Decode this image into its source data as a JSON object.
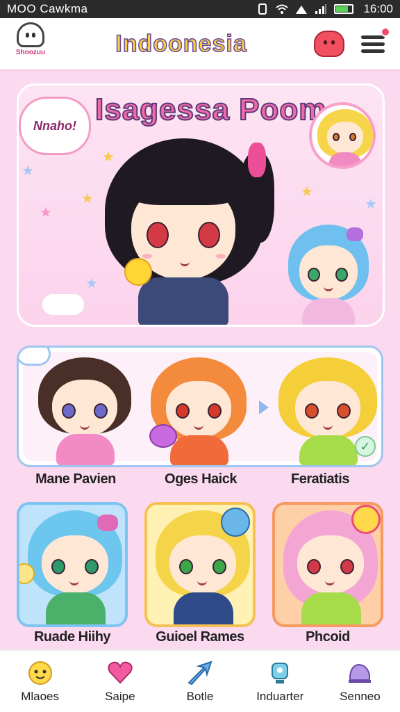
{
  "status": {
    "carrier": "MOO Cawkma",
    "time": "16:00"
  },
  "header": {
    "title": "Indoonesia",
    "logo_text": "Shoozuu"
  },
  "hero": {
    "title": "Isagessa Poom",
    "bubble_text": "Nnaho!"
  },
  "gallery": {
    "labels": [
      "Mane Pavien",
      "Oges Haick",
      "Feratiatis"
    ]
  },
  "cards": [
    {
      "label": "Ruade Hiihy",
      "border": "#7dc4f2",
      "bg": "#bfe3fb"
    },
    {
      "label": "Guioel Rames",
      "border": "#f6c152",
      "bg": "#fff1b3"
    },
    {
      "label": "Phcoid",
      "border": "#f59a60",
      "bg": "#ffd0a8"
    }
  ],
  "tabs": [
    {
      "label": "Mlaoes",
      "icon": "face-icon"
    },
    {
      "label": "Saipe",
      "icon": "heart-icon"
    },
    {
      "label": "Botle",
      "icon": "arrow-icon"
    },
    {
      "label": "Induarter",
      "icon": "trophy-icon"
    },
    {
      "label": "Senneo",
      "icon": "shoe-icon"
    }
  ],
  "colors": {
    "accent": "#f06aa8",
    "background": "#fbd9ef",
    "title_yellow": "#f4cf44"
  }
}
